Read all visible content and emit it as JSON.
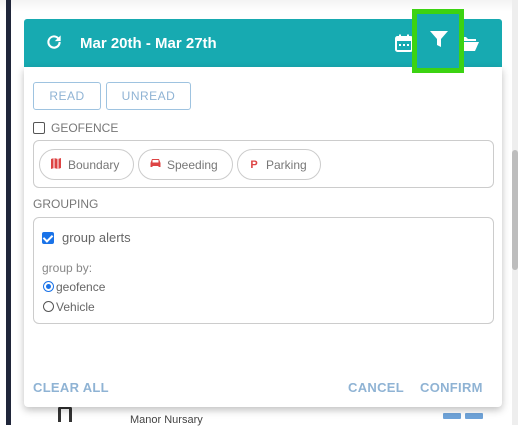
{
  "header": {
    "date_range": "Mar 20th - Mar 27th",
    "accent_color": "#17aab1",
    "highlight_color": "#3cd312",
    "icons": [
      "refresh-icon",
      "calendar-icon",
      "filter-icon",
      "folder-icon"
    ]
  },
  "filters": {
    "read_label": "READ",
    "unread_label": "UNREAD",
    "geofence_label": "GEOFENCE",
    "geofence_checked": false,
    "types": [
      {
        "label": "Boundary",
        "icon": "map-icon"
      },
      {
        "label": "Speeding",
        "icon": "car-icon"
      },
      {
        "label": "Parking",
        "icon": "parking-icon"
      }
    ]
  },
  "grouping": {
    "section_label": "GROUPING",
    "group_alerts_label": "group alerts",
    "group_alerts_checked": true,
    "group_by_label": "group by:",
    "options": [
      "geofence",
      "Vehicle"
    ],
    "selected": "geofence"
  },
  "actions": {
    "clear_all": "CLEAR ALL",
    "cancel": "CANCEL",
    "confirm": "CONFIRM"
  },
  "background_list": {
    "item_label": "Manor Nursary"
  }
}
